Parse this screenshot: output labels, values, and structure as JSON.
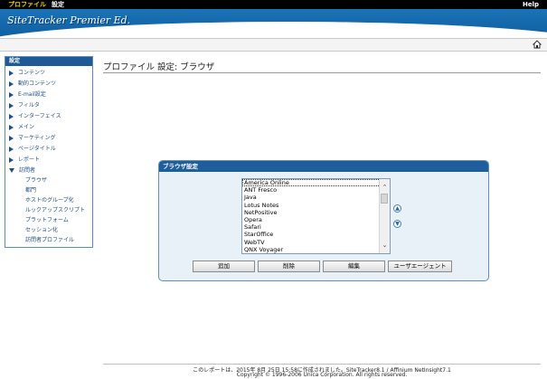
{
  "topbar": {
    "menu_profile": "プロファイル",
    "menu_settings": "設定",
    "menu_help": "Help"
  },
  "banner": {
    "logo": "SiteTracker Premier Ed."
  },
  "sidebar": {
    "header": "設定",
    "items": [
      {
        "label": "コンテンツ"
      },
      {
        "label": "動的コンテンツ"
      },
      {
        "label": "E-mail設定"
      },
      {
        "label": "フィルタ"
      },
      {
        "label": "インターフェイス"
      },
      {
        "label": "メイン"
      },
      {
        "label": "マーケティング"
      },
      {
        "label": "ページタイトル"
      },
      {
        "label": "レポート"
      },
      {
        "label": "訪問者"
      }
    ],
    "subitems": [
      {
        "label": "ブラウザ"
      },
      {
        "label": "都門"
      },
      {
        "label": "ホストのグループ化"
      },
      {
        "label": "ルックアップスクリプト"
      },
      {
        "label": "プラットフォーム"
      },
      {
        "label": "セッション化"
      },
      {
        "label": "訪問者プロファイル"
      }
    ]
  },
  "main": {
    "title": "プロファイル 設定: ブラウザ"
  },
  "panel": {
    "title": "ブラウザ設定",
    "options": [
      "America Online",
      "ANT Fresco",
      "Java",
      "Lotus Notes",
      "NetPositive",
      "Opera",
      "Safari",
      "StarOffice",
      "WebTV",
      "QNX Voyager"
    ],
    "buttons": {
      "add": "追加",
      "delete": "削除",
      "edit": "編集",
      "user_agent": "ユーザエージェント"
    }
  },
  "footer": {
    "line1": "このレポートは、2015年 8月 25日 15:58に作成されました。SiteTracker8.1 / Affinium NetInsight7.1",
    "line2": "Copyright © 1996-2006 Unica Corporation. All rights reserved."
  },
  "colors": {
    "nav_blue": "#1e4f86",
    "header_blue": "#1f5e9c",
    "panel_bg": "#e8f0f8"
  }
}
